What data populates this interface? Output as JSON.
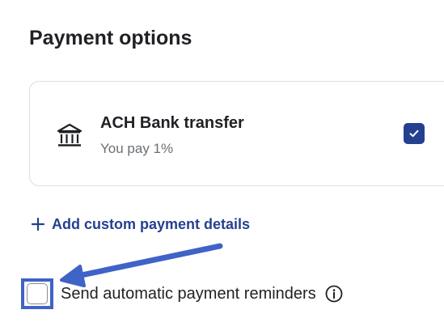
{
  "section_title": "Payment options",
  "payment_methods": [
    {
      "name": "ACH Bank transfer",
      "fee_text": "You pay 1%",
      "icon": "bank-icon",
      "checked": true
    }
  ],
  "add_link": {
    "icon": "plus-icon",
    "label": "Add custom payment details"
  },
  "reminders": {
    "label": "Send automatic payment reminders",
    "checked": false,
    "info_icon": "info-icon"
  },
  "colors": {
    "accent": "#25408f",
    "annotation": "#3f63c7",
    "text": "#1f2124",
    "muted": "#6b6f75",
    "border": "#dcdde0"
  }
}
